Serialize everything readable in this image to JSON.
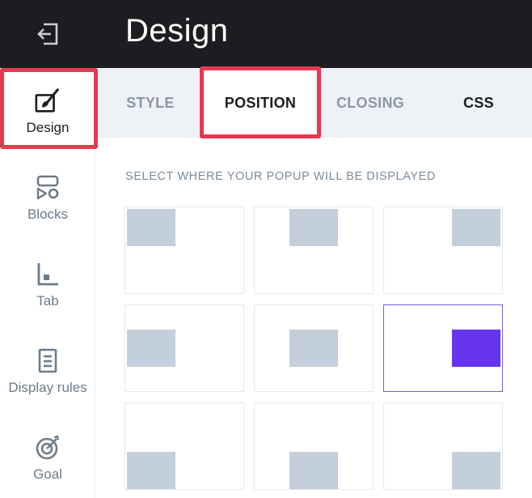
{
  "header": {
    "title": "Design"
  },
  "sidebar": {
    "items": [
      {
        "label": "Design",
        "icon": "paintbrush-icon"
      },
      {
        "label": "Blocks",
        "icon": "blocks-icon"
      },
      {
        "label": "Tab",
        "icon": "tab-icon"
      },
      {
        "label": "Display rules",
        "icon": "display-rules-icon"
      },
      {
        "label": "Goal",
        "icon": "goal-icon"
      }
    ]
  },
  "tabs": [
    {
      "label": "STYLE"
    },
    {
      "label": "POSITION"
    },
    {
      "label": "CLOSING"
    },
    {
      "label": "CSS"
    }
  ],
  "main": {
    "section_label": "SELECT WHERE YOUR POPUP WILL BE DISPLAYED",
    "positions": [
      "top-left",
      "top-center",
      "top-right",
      "middle-left",
      "middle-center",
      "middle-right",
      "bottom-left",
      "bottom-center",
      "bottom-right"
    ],
    "selected_position": "middle-right"
  },
  "colors": {
    "dark": "#1d1d21",
    "accent": "#6633ee",
    "highlight": "#e63950",
    "muted": "#c4cfdc"
  }
}
